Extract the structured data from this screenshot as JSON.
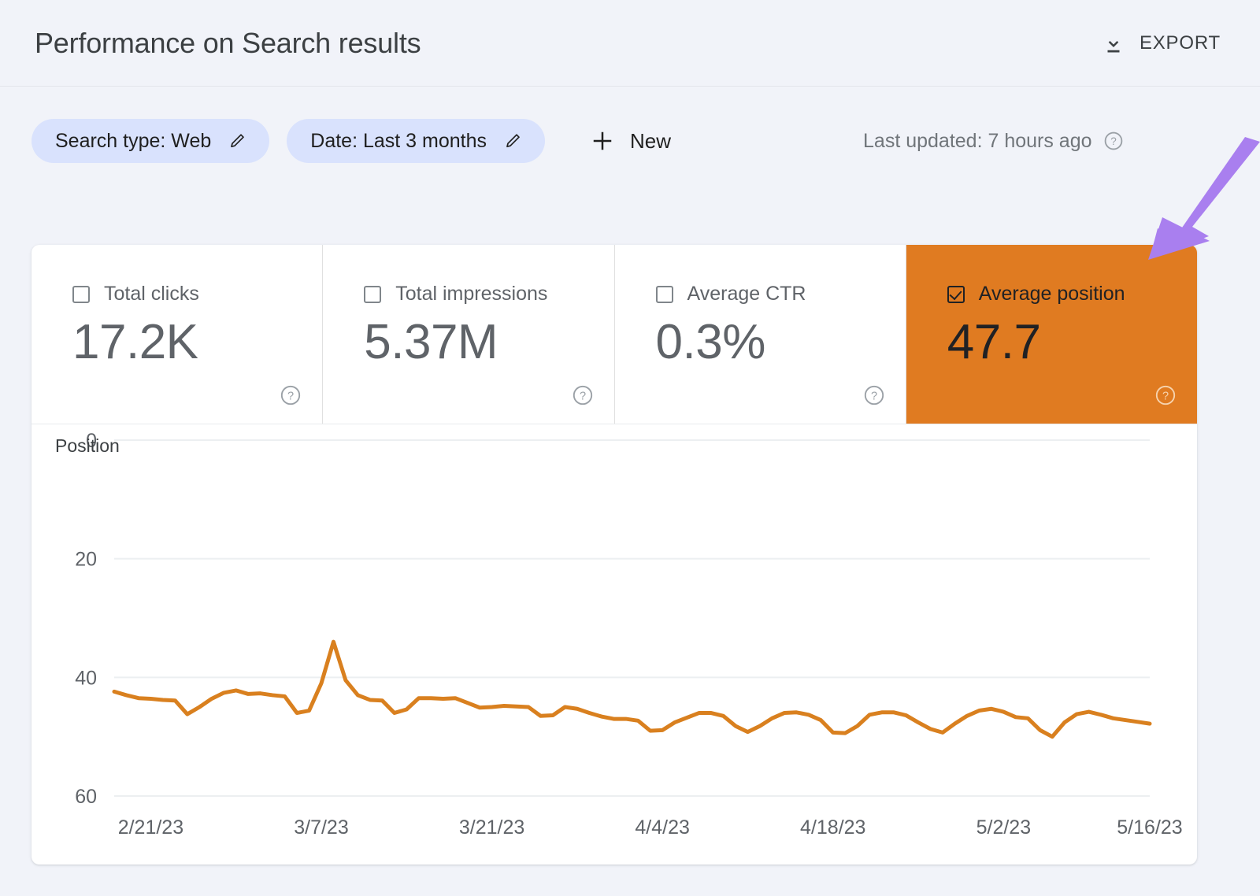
{
  "header": {
    "title": "Performance on Search results",
    "export_label": "EXPORT",
    "export_icon": "download-icon"
  },
  "filters": {
    "chips": [
      {
        "label": "Search type: Web",
        "edit_icon": "pencil-icon"
      },
      {
        "label": "Date: Last 3 months",
        "edit_icon": "pencil-icon"
      }
    ],
    "new_label": "New",
    "new_icon": "plus-icon",
    "last_updated": "Last updated: 7 hours ago",
    "help_icon": "help-circle-icon"
  },
  "metrics": [
    {
      "name": "Total clicks",
      "value": "17.2K",
      "selected": false,
      "help_icon": "help-circle-icon"
    },
    {
      "name": "Total impressions",
      "value": "5.37M",
      "selected": false,
      "help_icon": "help-circle-icon"
    },
    {
      "name": "Average CTR",
      "value": "0.3%",
      "selected": false,
      "help_icon": "help-circle-icon"
    },
    {
      "name": "Average position",
      "value": "47.7",
      "selected": true,
      "help_icon": "help-circle-icon"
    }
  ],
  "colors": {
    "background": "#f1f3f9",
    "card": "#ffffff",
    "chip": "#d9e2fd",
    "position_orange": "#e07b21",
    "line_orange": "#d9801f",
    "arrow_purple": "#a97fef",
    "text_primary": "#3c4043",
    "text_secondary": "#5f6368",
    "gridline": "#eceff1"
  },
  "annotation": {
    "arrow_icon": "arrow-down-left-icon",
    "target": "metric-average-position"
  },
  "chart_data": {
    "type": "line",
    "title": "",
    "ylabel": "Position",
    "xlabel": "",
    "ylim": [
      0,
      60
    ],
    "y_inverted": false,
    "yticks": [
      0,
      20,
      40,
      60
    ],
    "grid": true,
    "legend": "none",
    "line_color": "#d9801f",
    "x_tick_labels": [
      "2/21/23",
      "3/7/23",
      "3/21/23",
      "4/4/23",
      "4/18/23",
      "5/2/23",
      "5/16/23"
    ],
    "x_start_date": "2/18/23",
    "x_end_date": "5/20/23",
    "series": [
      {
        "name": "Average position",
        "values": [
          42.4,
          43.0,
          43.5,
          43.6,
          43.8,
          43.9,
          46.2,
          45.0,
          43.6,
          42.6,
          42.2,
          42.8,
          42.7,
          43.0,
          43.2,
          46.0,
          45.6,
          41.0,
          34.0,
          40.5,
          43.0,
          43.8,
          43.9,
          46.0,
          45.4,
          43.5,
          43.5,
          43.6,
          43.5,
          44.3,
          45.1,
          45.0,
          44.8,
          44.9,
          45.0,
          46.5,
          46.4,
          45.0,
          45.3,
          46.0,
          46.6,
          47.0,
          47.0,
          47.3,
          49.0,
          48.9,
          47.6,
          46.8,
          46.0,
          46.0,
          46.5,
          48.2,
          49.2,
          48.2,
          46.9,
          46.0,
          45.9,
          46.3,
          47.2,
          49.3,
          49.4,
          48.2,
          46.3,
          45.9,
          45.9,
          46.4,
          47.6,
          48.7,
          49.3,
          47.8,
          46.5,
          45.6,
          45.3,
          45.8,
          46.7,
          46.9,
          48.9,
          50.0,
          47.6,
          46.2,
          45.8,
          46.3,
          46.9,
          47.2,
          47.5,
          47.8
        ]
      }
    ]
  }
}
